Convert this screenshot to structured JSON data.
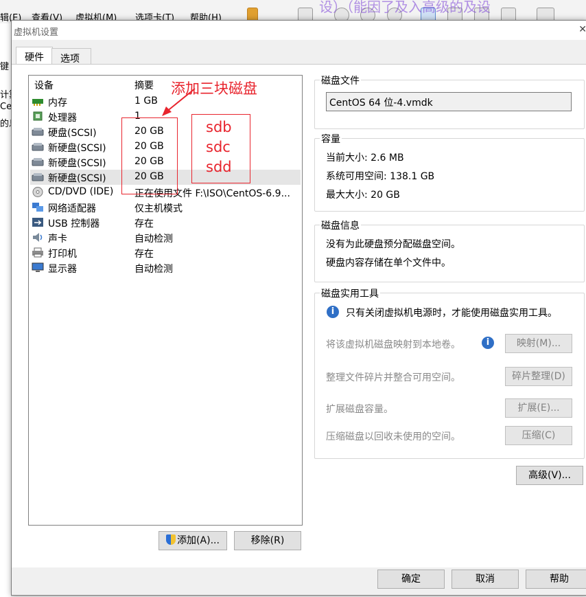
{
  "background_app": {
    "menus": [
      "辑(E)",
      "查看(V)",
      "虚拟机(M)",
      "选项卡(T)",
      "帮助(H)"
    ],
    "left_fragments": [
      "键",
      "计算",
      "Cen",
      "的息"
    ],
    "watermark": "设）（能因了及入高级的及设"
  },
  "dialog": {
    "title": "虚拟机设置",
    "close": "✕"
  },
  "tabs": [
    {
      "label": "硬件",
      "active": true
    },
    {
      "label": "选项",
      "active": false
    }
  ],
  "device_list": {
    "col_device": "设备",
    "col_summary": "摘要",
    "rows": [
      {
        "name": "内存",
        "summary": "1 GB",
        "icon": "memory-icon"
      },
      {
        "name": "处理器",
        "summary": "1",
        "icon": "processor-icon"
      },
      {
        "name": "硬盘(SCSI)",
        "summary": "20 GB",
        "icon": "hard-disk-icon"
      },
      {
        "name": "新硬盘(SCSI)",
        "summary": "20 GB",
        "icon": "hard-disk-icon"
      },
      {
        "name": "新硬盘(SCSI)",
        "summary": "20 GB",
        "icon": "hard-disk-icon"
      },
      {
        "name": "新硬盘(SCSI)",
        "summary": "20 GB",
        "icon": "hard-disk-icon",
        "selected": true
      },
      {
        "name": "CD/DVD (IDE)",
        "summary": "正在使用文件 F:\\ISO\\CentOS-6.9...",
        "icon": "cd-dvd-icon"
      },
      {
        "name": "网络适配器",
        "summary": "仅主机模式",
        "icon": "network-adapter-icon"
      },
      {
        "name": "USB 控制器",
        "summary": "存在",
        "icon": "usb-icon"
      },
      {
        "name": "声卡",
        "summary": "自动检测",
        "icon": "sound-card-icon"
      },
      {
        "name": "打印机",
        "summary": "存在",
        "icon": "printer-icon"
      },
      {
        "name": "显示器",
        "summary": "自动检测",
        "icon": "display-icon"
      }
    ]
  },
  "annotations": {
    "title": "添加三块磁盘",
    "disks": [
      "sdb",
      "sdc",
      "sdd"
    ],
    "color": "#e8242d"
  },
  "buttons": {
    "add": "添加(A)...",
    "remove": "移除(R)",
    "ok": "确定",
    "cancel": "取消",
    "help": "帮助",
    "advanced": "高级(V)..."
  },
  "disk_file": {
    "title": "磁盘文件",
    "value": "CentOS 64 位-4.vmdk"
  },
  "capacity": {
    "title": "容量",
    "current_size": "当前大小: 2.6 MB",
    "system_available": "系统可用空间: 138.1 GB",
    "max_size": "最大大小: 20 GB"
  },
  "disk_info": {
    "title": "磁盘信息",
    "line1": "没有为此硬盘预分配磁盘空间。",
    "line2": "硬盘内容存储在单个文件中。"
  },
  "disk_utilities": {
    "title": "磁盘实用工具",
    "notice": "只有关闭虚拟机电源时，才能使用磁盘实用工具。",
    "map_desc": "将该虚拟机磁盘映射到本地卷。",
    "map_btn": "映射(M)...",
    "defrag_desc": "整理文件碎片并整合可用空间。",
    "defrag_btn": "碎片整理(D)",
    "expand_desc": "扩展磁盘容量。",
    "expand_btn": "扩展(E)...",
    "compact_desc": "压缩磁盘以回收未使用的空间。",
    "compact_btn": "压缩(C)"
  }
}
